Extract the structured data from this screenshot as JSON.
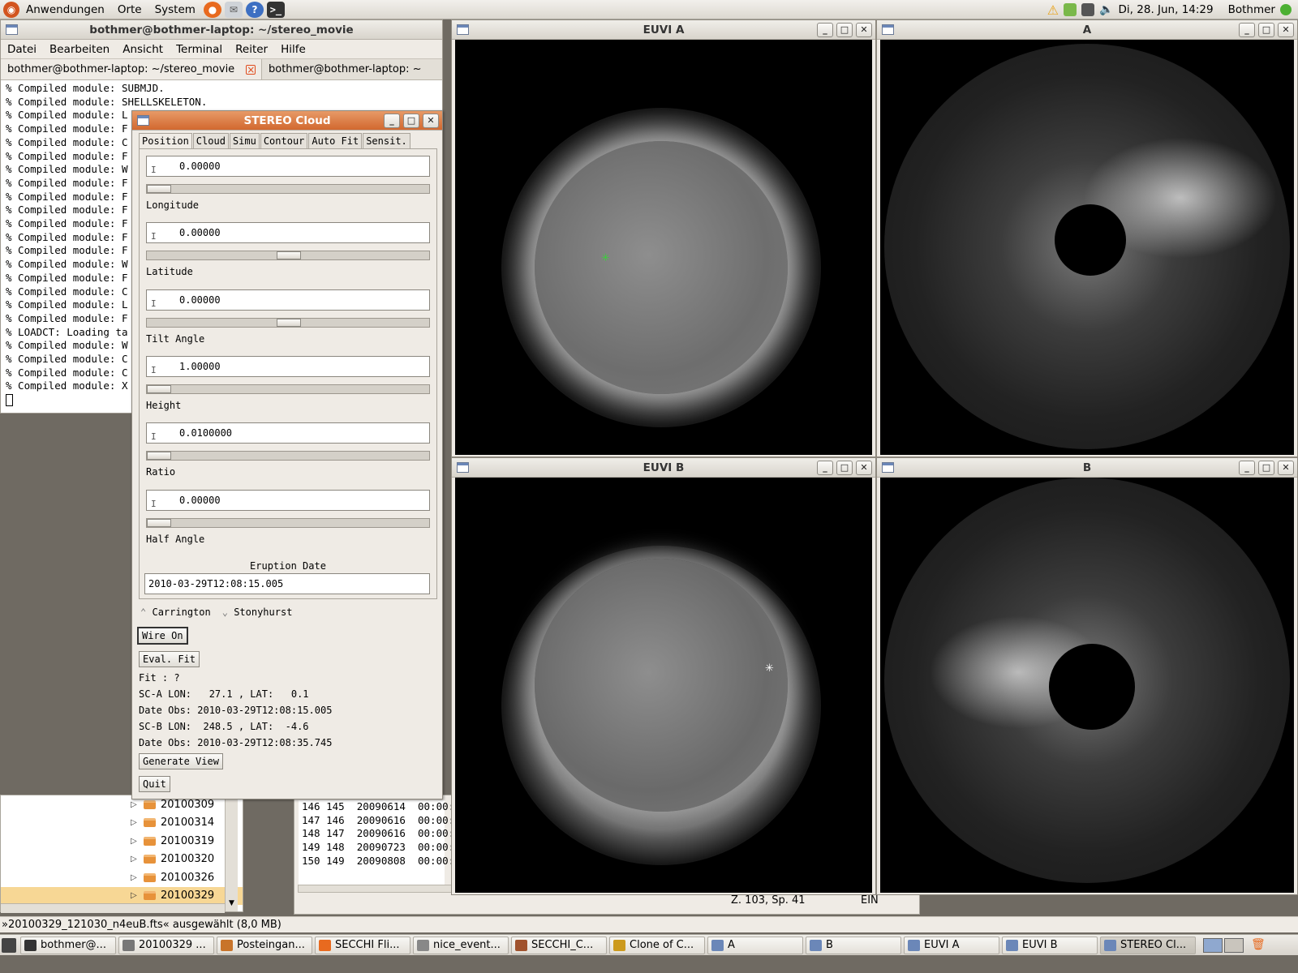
{
  "top_panel": {
    "menus": [
      "Anwendungen",
      "Orte",
      "System"
    ],
    "clock": "Di, 28. Jun, 14:29",
    "user": "Bothmer",
    "launchers": [
      "firefox-icon",
      "mail-icon",
      "help-icon",
      "terminal-icon"
    ]
  },
  "terminal": {
    "title": "bothmer@bothmer-laptop: ~/stereo_movie",
    "menu": [
      "Datei",
      "Bearbeiten",
      "Ansicht",
      "Terminal",
      "Reiter",
      "Hilfe"
    ],
    "tabs": [
      "bothmer@bothmer-laptop: ~/stereo_movie",
      "bothmer@bothmer-laptop: ~"
    ],
    "lines": [
      "% Compiled module: SUBMJD.",
      "% Compiled module: SHELLSKELETON.",
      "% Compiled module: L",
      "% Compiled module: F",
      "% Compiled module: C",
      "% Compiled module: F",
      "% Compiled module: W",
      "% Compiled module: F",
      "% Compiled module: F",
      "% Compiled module: F",
      "% Compiled module: F",
      "% Compiled module: F",
      "% Compiled module: F",
      "% Compiled module: W",
      "% Compiled module: F",
      "% Compiled module: C",
      "% Compiled module: L",
      "% Compiled module: F",
      "% LOADCT: Loading ta",
      "% Compiled module: W",
      "% Compiled module: C",
      "% Compiled module: C",
      "% Compiled module: X"
    ]
  },
  "file_tree": {
    "items": [
      "20100309",
      "20100314",
      "20100319",
      "20100320",
      "20100326",
      "20100329"
    ],
    "selected": "20100329"
  },
  "editor": {
    "lines": [
      "146 145  20090614  00:00:",
      "147 146  20090616  00:00:",
      "148 147  20090616  00:00:",
      "149 148  20090723  00:00:",
      "150 149  20090808  00:00:"
    ],
    "position": "Z. 103, Sp. 41",
    "mode": "EIN"
  },
  "cloud": {
    "title": "STEREO Cloud",
    "tabs": [
      "Position",
      "Cloud",
      "Simu",
      "Contour",
      "Auto Fit",
      "Sensit."
    ],
    "fields": [
      {
        "label": "Longitude",
        "value": "0.00000"
      },
      {
        "label": "Latitude",
        "value": "0.00000"
      },
      {
        "label": "Tilt Angle",
        "value": "0.00000"
      },
      {
        "label": "Height",
        "value": "1.00000"
      },
      {
        "label": "Ratio",
        "value": "0.0100000"
      },
      {
        "label": "Half Angle",
        "value": "0.00000"
      }
    ],
    "eruption_label": "Eruption Date",
    "eruption_value": "2010-03-29T12:08:15.005",
    "radio_carrington": "Carrington",
    "radio_stonyhurst": "Stonyhurst",
    "wire_button": "Wire On",
    "eval_button": "Eval. Fit",
    "fit": "Fit : ?",
    "sca": "SC-A LON:   27.1 , LAT:   0.1",
    "sca_date": "Date Obs: 2010-03-29T12:08:15.005",
    "scb": "SC-B LON:  248.5 , LAT:  -4.6",
    "scb_date": "Date Obs: 2010-03-29T12:08:35.745",
    "generate_button": "Generate View",
    "quit_button": "Quit"
  },
  "image_windows": {
    "euvi_a": "EUVI A",
    "cor_a": "A",
    "euvi_b": "EUVI B",
    "cor_b": "B"
  },
  "status": "»20100329_121030_n4euB.fts« ausgewählt (8,0 MB)",
  "taskbar": [
    "bothmer@...",
    "20100329 ...",
    "Posteingan...",
    "SECCHI Fli...",
    "nice_event...",
    "SECCHI_C...",
    "Clone of C...",
    "A",
    "B",
    "EUVI A",
    "EUVI B",
    "STEREO Cl..."
  ],
  "colors": {
    "panel": "#dcd8d0",
    "selection": "#f7d795",
    "accent": "#e04b1d"
  }
}
